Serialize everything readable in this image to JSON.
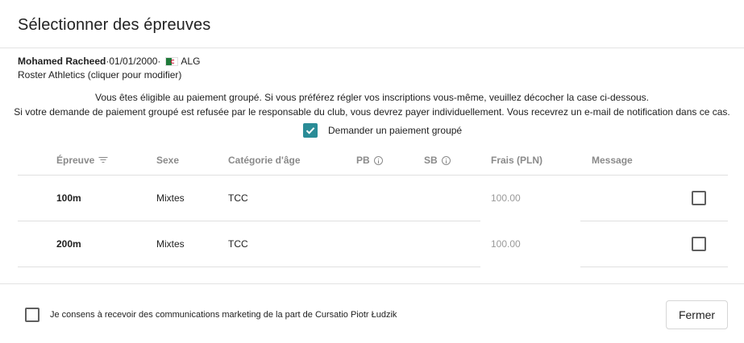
{
  "dialog": {
    "title": "Sélectionner des épreuves"
  },
  "athlete": {
    "name": "Mohamed Racheed",
    "sep1": " · ",
    "birthdate": "01/01/2000",
    "sep2": " · ",
    "country": "ALG",
    "flag_icon": "algeria-flag-icon",
    "club": "Roster Athletics (cliquer pour modifier)"
  },
  "notice": {
    "line1": "Vous êtes éligible au paiement groupé. Si vous préférez régler vos inscriptions vous-même, veuillez décocher la case ci-dessous.",
    "line2": "Si votre demande de paiement groupé est refusée par le responsable du club, vous devrez payer individuellement. Vous recevrez un e-mail de notification dans ce cas."
  },
  "group_payment": {
    "label": "Demander un paiement groupé",
    "checked": true,
    "color": "#2a8c97"
  },
  "table": {
    "headers": {
      "event": "Épreuve",
      "sex": "Sexe",
      "age_category": "Catégorie d'âge",
      "pb": "PB",
      "sb": "SB",
      "fee": "Frais (PLN)",
      "message": "Message"
    },
    "rows": [
      {
        "event": "100m",
        "sex": "Mixtes",
        "age_category": "TCC",
        "pb": "",
        "sb": "",
        "fee": "100.00",
        "message": "",
        "selected": false
      },
      {
        "event": "200m",
        "sex": "Mixtes",
        "age_category": "TCC",
        "pb": "",
        "sb": "",
        "fee": "100.00",
        "message": "",
        "selected": false
      }
    ]
  },
  "footer": {
    "consent_label": "Je consens à recevoir des communications marketing de la part de Cursatio Piotr Łudzik",
    "consent_checked": false,
    "close_label": "Fermer"
  }
}
